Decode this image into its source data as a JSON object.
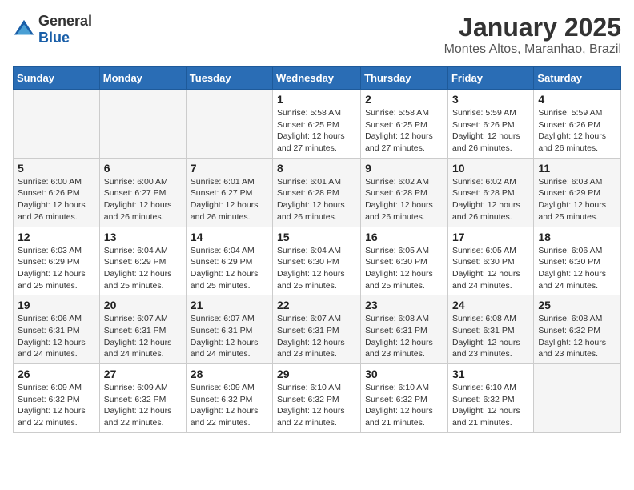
{
  "header": {
    "logo": {
      "general": "General",
      "blue": "Blue"
    },
    "title": "January 2025",
    "subtitle": "Montes Altos, Maranhao, Brazil"
  },
  "weekdays": [
    "Sunday",
    "Monday",
    "Tuesday",
    "Wednesday",
    "Thursday",
    "Friday",
    "Saturday"
  ],
  "weeks": [
    [
      {
        "day": "",
        "info": ""
      },
      {
        "day": "",
        "info": ""
      },
      {
        "day": "",
        "info": ""
      },
      {
        "day": "1",
        "info": "Sunrise: 5:58 AM\nSunset: 6:25 PM\nDaylight: 12 hours\nand 27 minutes."
      },
      {
        "day": "2",
        "info": "Sunrise: 5:58 AM\nSunset: 6:25 PM\nDaylight: 12 hours\nand 27 minutes."
      },
      {
        "day": "3",
        "info": "Sunrise: 5:59 AM\nSunset: 6:26 PM\nDaylight: 12 hours\nand 26 minutes."
      },
      {
        "day": "4",
        "info": "Sunrise: 5:59 AM\nSunset: 6:26 PM\nDaylight: 12 hours\nand 26 minutes."
      }
    ],
    [
      {
        "day": "5",
        "info": "Sunrise: 6:00 AM\nSunset: 6:26 PM\nDaylight: 12 hours\nand 26 minutes."
      },
      {
        "day": "6",
        "info": "Sunrise: 6:00 AM\nSunset: 6:27 PM\nDaylight: 12 hours\nand 26 minutes."
      },
      {
        "day": "7",
        "info": "Sunrise: 6:01 AM\nSunset: 6:27 PM\nDaylight: 12 hours\nand 26 minutes."
      },
      {
        "day": "8",
        "info": "Sunrise: 6:01 AM\nSunset: 6:28 PM\nDaylight: 12 hours\nand 26 minutes."
      },
      {
        "day": "9",
        "info": "Sunrise: 6:02 AM\nSunset: 6:28 PM\nDaylight: 12 hours\nand 26 minutes."
      },
      {
        "day": "10",
        "info": "Sunrise: 6:02 AM\nSunset: 6:28 PM\nDaylight: 12 hours\nand 26 minutes."
      },
      {
        "day": "11",
        "info": "Sunrise: 6:03 AM\nSunset: 6:29 PM\nDaylight: 12 hours\nand 25 minutes."
      }
    ],
    [
      {
        "day": "12",
        "info": "Sunrise: 6:03 AM\nSunset: 6:29 PM\nDaylight: 12 hours\nand 25 minutes."
      },
      {
        "day": "13",
        "info": "Sunrise: 6:04 AM\nSunset: 6:29 PM\nDaylight: 12 hours\nand 25 minutes."
      },
      {
        "day": "14",
        "info": "Sunrise: 6:04 AM\nSunset: 6:29 PM\nDaylight: 12 hours\nand 25 minutes."
      },
      {
        "day": "15",
        "info": "Sunrise: 6:04 AM\nSunset: 6:30 PM\nDaylight: 12 hours\nand 25 minutes."
      },
      {
        "day": "16",
        "info": "Sunrise: 6:05 AM\nSunset: 6:30 PM\nDaylight: 12 hours\nand 25 minutes."
      },
      {
        "day": "17",
        "info": "Sunrise: 6:05 AM\nSunset: 6:30 PM\nDaylight: 12 hours\nand 24 minutes."
      },
      {
        "day": "18",
        "info": "Sunrise: 6:06 AM\nSunset: 6:30 PM\nDaylight: 12 hours\nand 24 minutes."
      }
    ],
    [
      {
        "day": "19",
        "info": "Sunrise: 6:06 AM\nSunset: 6:31 PM\nDaylight: 12 hours\nand 24 minutes."
      },
      {
        "day": "20",
        "info": "Sunrise: 6:07 AM\nSunset: 6:31 PM\nDaylight: 12 hours\nand 24 minutes."
      },
      {
        "day": "21",
        "info": "Sunrise: 6:07 AM\nSunset: 6:31 PM\nDaylight: 12 hours\nand 24 minutes."
      },
      {
        "day": "22",
        "info": "Sunrise: 6:07 AM\nSunset: 6:31 PM\nDaylight: 12 hours\nand 23 minutes."
      },
      {
        "day": "23",
        "info": "Sunrise: 6:08 AM\nSunset: 6:31 PM\nDaylight: 12 hours\nand 23 minutes."
      },
      {
        "day": "24",
        "info": "Sunrise: 6:08 AM\nSunset: 6:31 PM\nDaylight: 12 hours\nand 23 minutes."
      },
      {
        "day": "25",
        "info": "Sunrise: 6:08 AM\nSunset: 6:32 PM\nDaylight: 12 hours\nand 23 minutes."
      }
    ],
    [
      {
        "day": "26",
        "info": "Sunrise: 6:09 AM\nSunset: 6:32 PM\nDaylight: 12 hours\nand 22 minutes."
      },
      {
        "day": "27",
        "info": "Sunrise: 6:09 AM\nSunset: 6:32 PM\nDaylight: 12 hours\nand 22 minutes."
      },
      {
        "day": "28",
        "info": "Sunrise: 6:09 AM\nSunset: 6:32 PM\nDaylight: 12 hours\nand 22 minutes."
      },
      {
        "day": "29",
        "info": "Sunrise: 6:10 AM\nSunset: 6:32 PM\nDaylight: 12 hours\nand 22 minutes."
      },
      {
        "day": "30",
        "info": "Sunrise: 6:10 AM\nSunset: 6:32 PM\nDaylight: 12 hours\nand 21 minutes."
      },
      {
        "day": "31",
        "info": "Sunrise: 6:10 AM\nSunset: 6:32 PM\nDaylight: 12 hours\nand 21 minutes."
      },
      {
        "day": "",
        "info": ""
      }
    ]
  ]
}
